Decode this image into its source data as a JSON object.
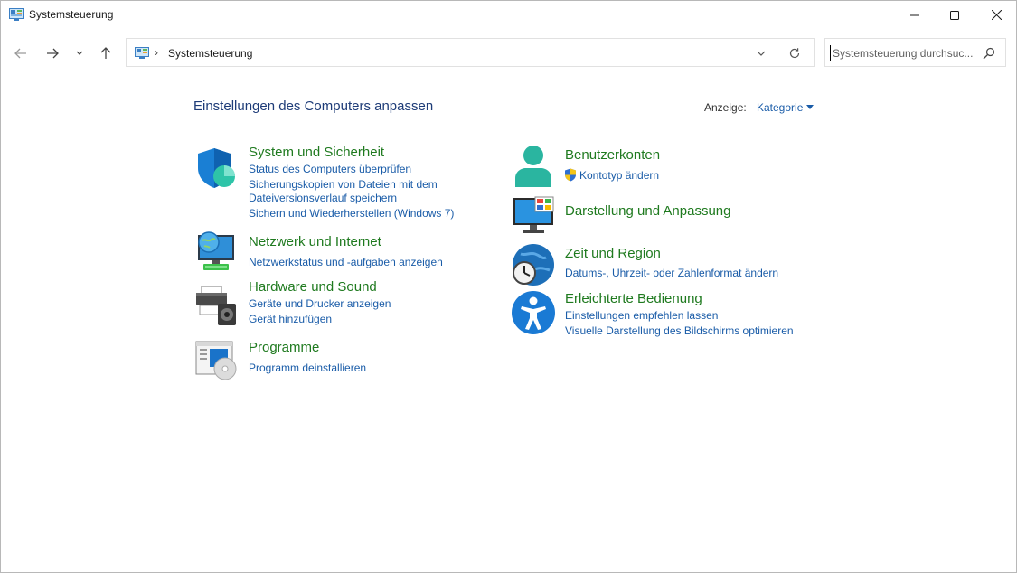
{
  "window": {
    "title": "Systemsteuerung",
    "controls": {
      "minimize": "minimize-icon",
      "maximize": "maximize-icon",
      "close": "close-icon"
    }
  },
  "nav": {
    "back": "back-arrow-icon",
    "forward": "forward-arrow-icon",
    "recent": "chevron-down-icon",
    "up": "up-arrow-icon"
  },
  "address": {
    "separator": "›",
    "path": "Systemsteuerung"
  },
  "search": {
    "placeholder": "Systemsteuerung durchsuc..."
  },
  "main": {
    "heading": "Einstellungen des Computers anpassen",
    "view_label": "Anzeige:",
    "view_value": "Kategorie"
  },
  "categories_left": [
    {
      "title": "System und Sicherheit",
      "icon": "shield-icon",
      "links": [
        "Status des Computers überprüfen",
        "Sicherungskopien von Dateien mit dem",
        "Dateiversionsverlauf speichern",
        "Sichern und Wiederherstellen (Windows 7)"
      ]
    },
    {
      "title": "Netzwerk und Internet",
      "icon": "network-globe-icon",
      "links": [
        "Netzwerkstatus und -aufgaben anzeigen"
      ]
    },
    {
      "title": "Hardware und Sound",
      "icon": "printer-speaker-icon",
      "links": [
        "Geräte und Drucker anzeigen",
        "Gerät hinzufügen"
      ]
    },
    {
      "title": "Programme",
      "icon": "programs-disc-icon",
      "links": [
        "Programm deinstallieren"
      ]
    }
  ],
  "categories_right": [
    {
      "title": "Benutzerkonten",
      "icon": "user-icon",
      "links": [
        "Kontotyp ändern"
      ]
    },
    {
      "title": "Darstellung und Anpassung",
      "icon": "monitor-icon",
      "links": []
    },
    {
      "title": "Zeit und Region",
      "icon": "clock-globe-icon",
      "links": [
        "Datums-, Uhrzeit- oder Zahlenformat ändern"
      ]
    },
    {
      "title": "Erleichterte Bedienung",
      "icon": "accessibility-icon",
      "links": [
        "Einstellungen empfehlen lassen",
        "Visuelle Darstellung des Bildschirms optimieren"
      ]
    }
  ],
  "colors": {
    "heading": "#1e3c78",
    "category_title": "#1f7a1f",
    "link": "#1a5ca8"
  }
}
